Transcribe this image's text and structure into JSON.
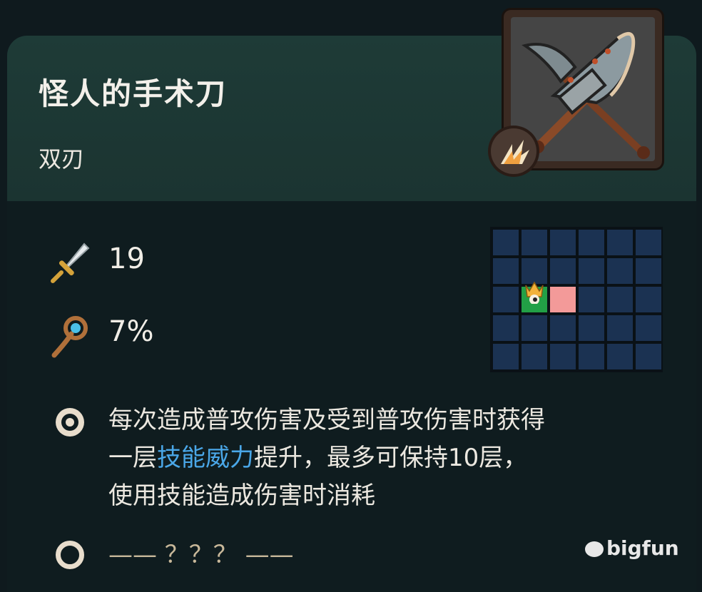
{
  "item": {
    "name": "怪人的手术刀",
    "type": "双刃",
    "portrait_icon": "crossed-blades-icon",
    "badge_icon": "burst-icon"
  },
  "stats": {
    "attack": {
      "icon": "sword-icon",
      "value": "19"
    },
    "crit": {
      "icon": "staff-icon",
      "value": "7%"
    }
  },
  "range_grid": {
    "cols": 6,
    "rows": 5,
    "self_cell": [
      2,
      1
    ],
    "hit_cells": [
      [
        2,
        2
      ]
    ]
  },
  "effects": [
    {
      "bullet_icon": "filled-ring-icon",
      "line1": "每次造成普攻伤害及受到普攻伤害时获得",
      "line2_pre": "一层",
      "line2_keyword": "技能威力",
      "line2_post": "提升，最多可保持10层，",
      "line3": "使用技能造成伤害时消耗"
    },
    {
      "bullet_icon": "empty-ring-icon",
      "text": "—— ？？？ ——"
    }
  ],
  "watermark": "bigfun",
  "colors": {
    "header_bg": "#1e3b37",
    "card_bg": "#0f1c1f",
    "keyword": "#4aa7e8",
    "grid_cell": "#1b3252",
    "grid_hit": "#f39a99",
    "grid_self": "#22a046",
    "bullet": "#e8ddcc"
  }
}
